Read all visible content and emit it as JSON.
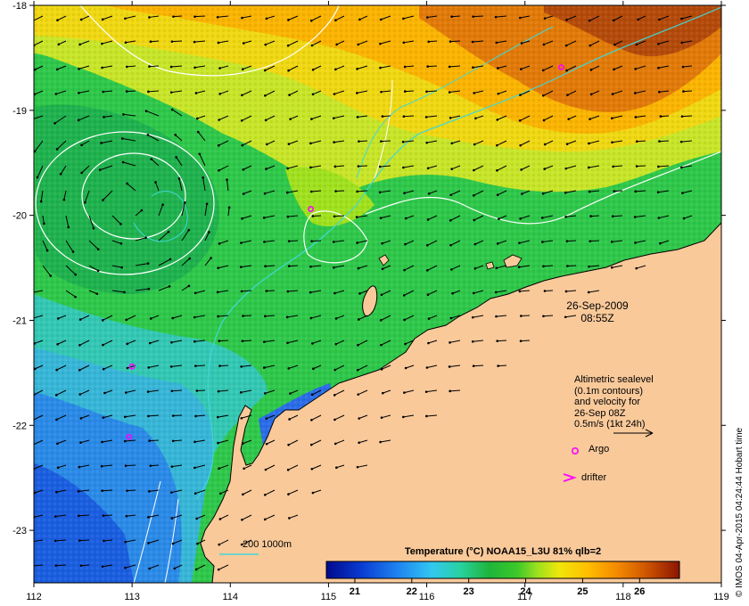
{
  "map": {
    "lon_ticks": [
      112,
      113,
      114,
      115,
      116,
      117,
      118,
      119
    ],
    "lat_ticks": [
      -18,
      -19,
      -20,
      -21,
      -22,
      -23
    ],
    "lon_range": [
      112,
      119
    ],
    "lat_range": [
      -23.5,
      -18
    ],
    "timestamp": {
      "date": "26-Sep-2009",
      "time": "08:55Z"
    },
    "altimetry_note": [
      "Altimetric sealevel",
      "(0.1m contours)",
      "and velocity for",
      "26-Sep 08Z",
      "0.5m/s (1kt 24h)"
    ],
    "argo_label": "Argo",
    "drifter_label": "drifter",
    "isobath_label": "200  1000m",
    "credit": "© IMOS 04-Apr-2015 04:24:44 Hobart time",
    "colorbar": {
      "title": "Temperature (°C) NOAA15_L3U 81% qlb=2",
      "ticks": [
        21,
        22,
        23,
        24,
        25,
        26
      ],
      "range": [
        20.5,
        26.7
      ]
    },
    "argo_floats": [
      {
        "lon": 117.37,
        "lat": -18.59
      },
      {
        "lon": 114.82,
        "lat": -19.94
      },
      {
        "lon": 113.0,
        "lat": -21.44
      },
      {
        "lon": 112.97,
        "lat": -22.11
      }
    ],
    "colors": {
      "land": "#f9c99a",
      "coast": "#000000",
      "contour": "#ffffff",
      "isobath": "#40d8d8",
      "argo": "#ff00ff",
      "drifter": "#ff00ff"
    }
  }
}
